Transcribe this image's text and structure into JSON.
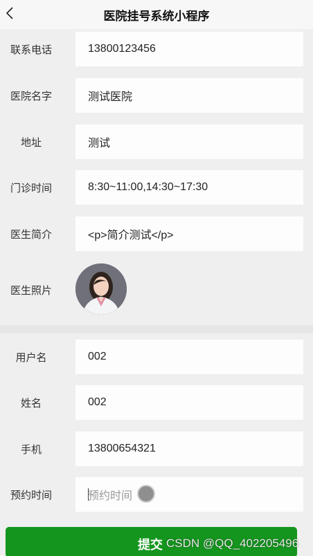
{
  "nav": {
    "title": "医院挂号系统小程序"
  },
  "hospital": {
    "phone_label": "联系电话",
    "phone_value": "13800123456",
    "name_label": "医院名字",
    "name_value": "测试医院",
    "address_label": "地址",
    "address_value": "测试",
    "hours_label": "门诊时间",
    "hours_value": "8:30~11:00,14:30~17:30",
    "intro_label": "医生简介",
    "intro_value": "<p>简介测试</p>",
    "photo_label": "医生照片"
  },
  "user": {
    "username_label": "用户名",
    "username_value": "002",
    "name_label": "姓名",
    "name_value": "002",
    "phone_label": "手机",
    "phone_value": "13800654321",
    "time_label": "预约时间",
    "time_placeholder": "预约时间"
  },
  "submit": {
    "label": "提交"
  },
  "watermark": "CSDN @QQ_402205496",
  "colors": {
    "accent": "#14961e"
  }
}
